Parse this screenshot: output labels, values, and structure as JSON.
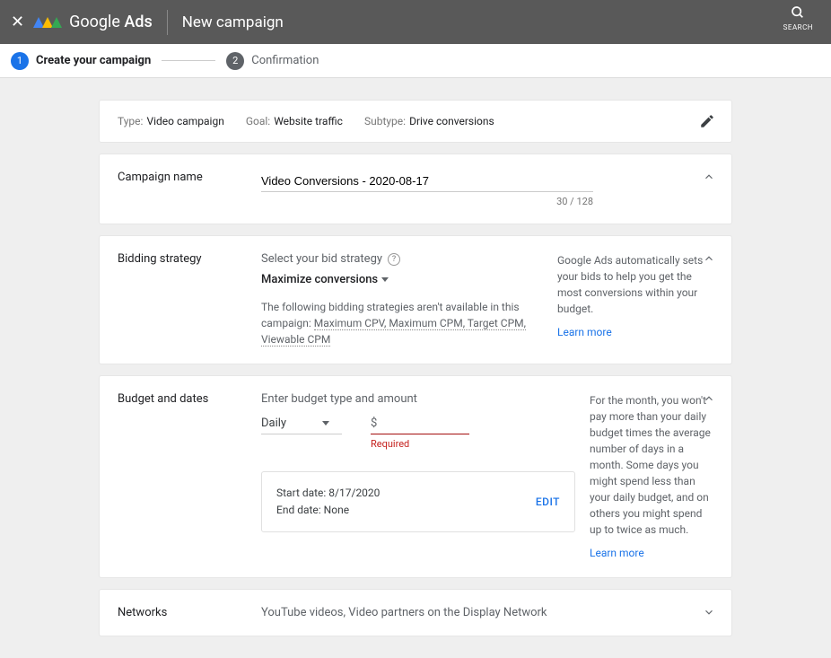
{
  "topbar": {
    "brand_left": "Google",
    "brand_right": "Ads",
    "page_title": "New campaign",
    "search_label": "SEARCH"
  },
  "stepper": {
    "step1_num": "1",
    "step1_label": "Create your campaign",
    "step2_num": "2",
    "step2_label": "Confirmation"
  },
  "summary": {
    "type_k": "Type:",
    "type_v": "Video campaign",
    "goal_k": "Goal:",
    "goal_v": "Website traffic",
    "subtype_k": "Subtype:",
    "subtype_v": "Drive conversions"
  },
  "campaign_name": {
    "label": "Campaign name",
    "value": "Video Conversions - 2020-08-17",
    "counter": "30 / 128"
  },
  "bidding": {
    "label": "Bidding strategy",
    "select_label": "Select your bid strategy",
    "value": "Maximize conversions",
    "note_prefix": "The following bidding strategies aren't available in this campaign: ",
    "note_links": "Maximum CPV, Maximum CPM, Target CPM, Viewable CPM",
    "info": "Google Ads automatically sets your bids to help you get the most conversions within your budget.",
    "learn": "Learn more"
  },
  "budget": {
    "label": "Budget and dates",
    "heading": "Enter budget type and amount",
    "type_value": "Daily",
    "currency": "$",
    "required": "Required",
    "start_line": "Start date: 8/17/2020",
    "end_line": "End date: None",
    "edit": "EDIT",
    "info": "For the month, you won't pay more than your daily budget times the average number of days in a month. Some days you might spend less than your daily budget, and on others you might spend up to twice as much.",
    "learn": "Learn more"
  },
  "networks": {
    "label": "Networks",
    "value": "YouTube videos, Video partners on the Display Network"
  }
}
